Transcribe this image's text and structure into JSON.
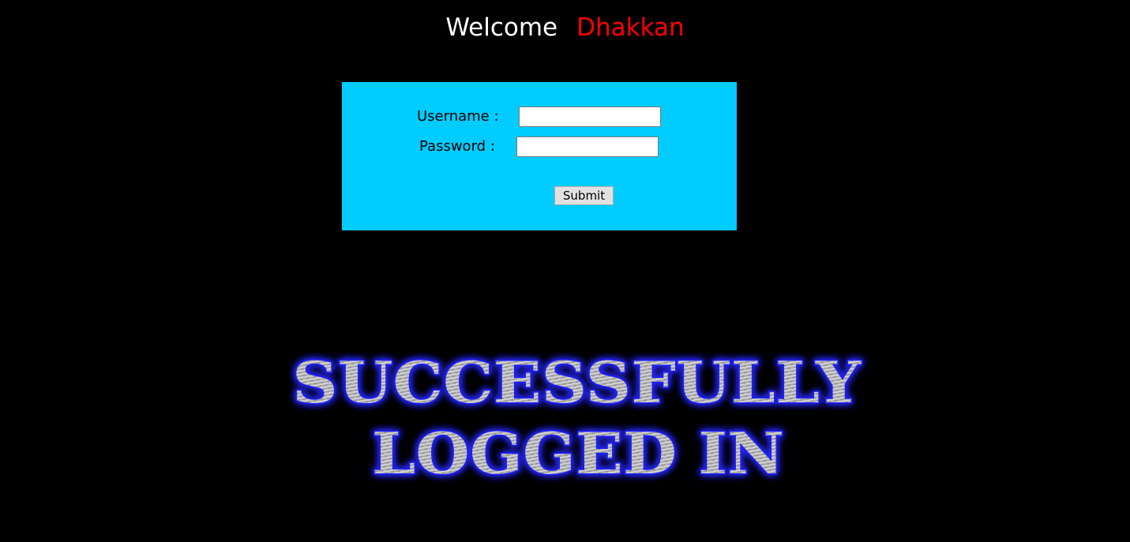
{
  "header": {
    "welcome": "Welcome",
    "username": "Dhakkan"
  },
  "login_form": {
    "username_label": "Username :",
    "username_value": "",
    "password_label": "Password :",
    "password_value": "",
    "submit_label": "Submit"
  },
  "banner": {
    "line1": "SUCCESSFULLY",
    "line2": "LOGGED IN"
  }
}
